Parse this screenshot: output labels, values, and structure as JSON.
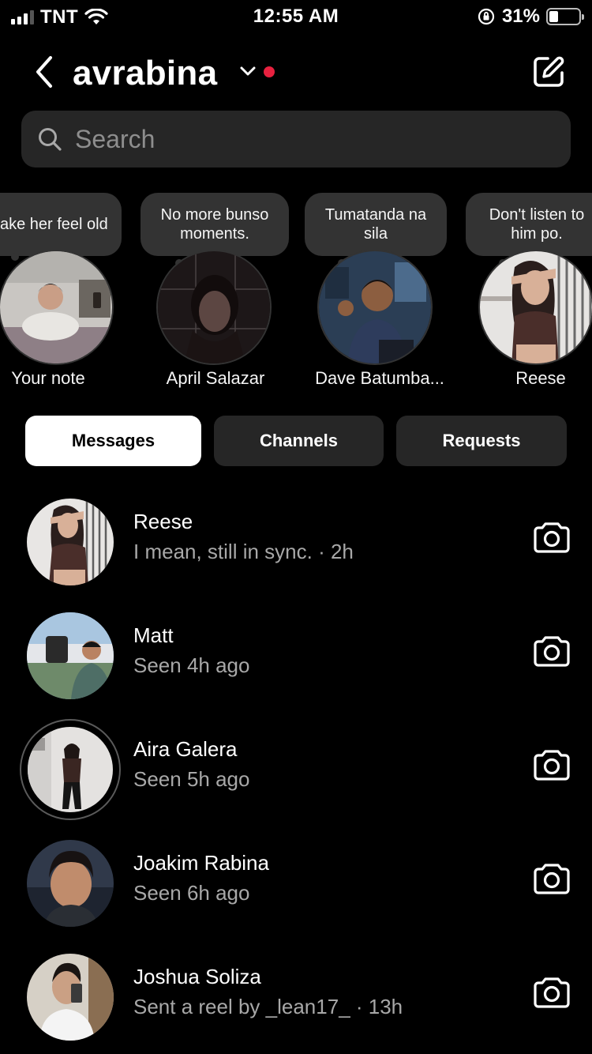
{
  "status_bar": {
    "carrier": "TNT",
    "time": "12:55 AM",
    "battery_percent": "31%",
    "battery_level": 0.31,
    "icons": [
      "signal-bars-icon",
      "wifi-icon",
      "orientation-lock-icon",
      "battery-icon"
    ]
  },
  "header": {
    "account_name": "avrabina",
    "back_icon": "chevron-left-icon",
    "dropdown_icon": "chevron-down-icon",
    "compose_icon": "compose-icon",
    "notification_dot_color": "#e8213f"
  },
  "search": {
    "placeholder": "Search",
    "value": "",
    "icon": "search-icon"
  },
  "notes": [
    {
      "text": "make her feel old",
      "name": "Your note"
    },
    {
      "text": "No more bunso moments.",
      "name": "April Salazar"
    },
    {
      "text": "Tumatanda na sila",
      "name": "Dave Batumba..."
    },
    {
      "text": "Don't listen to him po.",
      "name": "Reese"
    }
  ],
  "tabs": [
    {
      "label": "Messages",
      "active": true
    },
    {
      "label": "Channels",
      "active": false
    },
    {
      "label": "Requests",
      "active": false
    }
  ],
  "threads": [
    {
      "name": "Reese",
      "subtitle": "I mean, still in sync. · 2h",
      "has_story_ring": false
    },
    {
      "name": "Matt",
      "subtitle": "Seen 4h ago",
      "has_story_ring": false
    },
    {
      "name": "Aira Galera",
      "subtitle": "Seen 5h ago",
      "has_story_ring": true
    },
    {
      "name": "Joakim Rabina",
      "subtitle": "Seen 6h ago",
      "has_story_ring": false
    },
    {
      "name": "Joshua Soliza",
      "subtitle": "Sent a reel by _lean17_ · 13h",
      "has_story_ring": false
    }
  ],
  "colors": {
    "background": "#000000",
    "surface": "#262626",
    "secondary_text": "#a8a8a8",
    "active_tab_bg": "#ffffff"
  }
}
